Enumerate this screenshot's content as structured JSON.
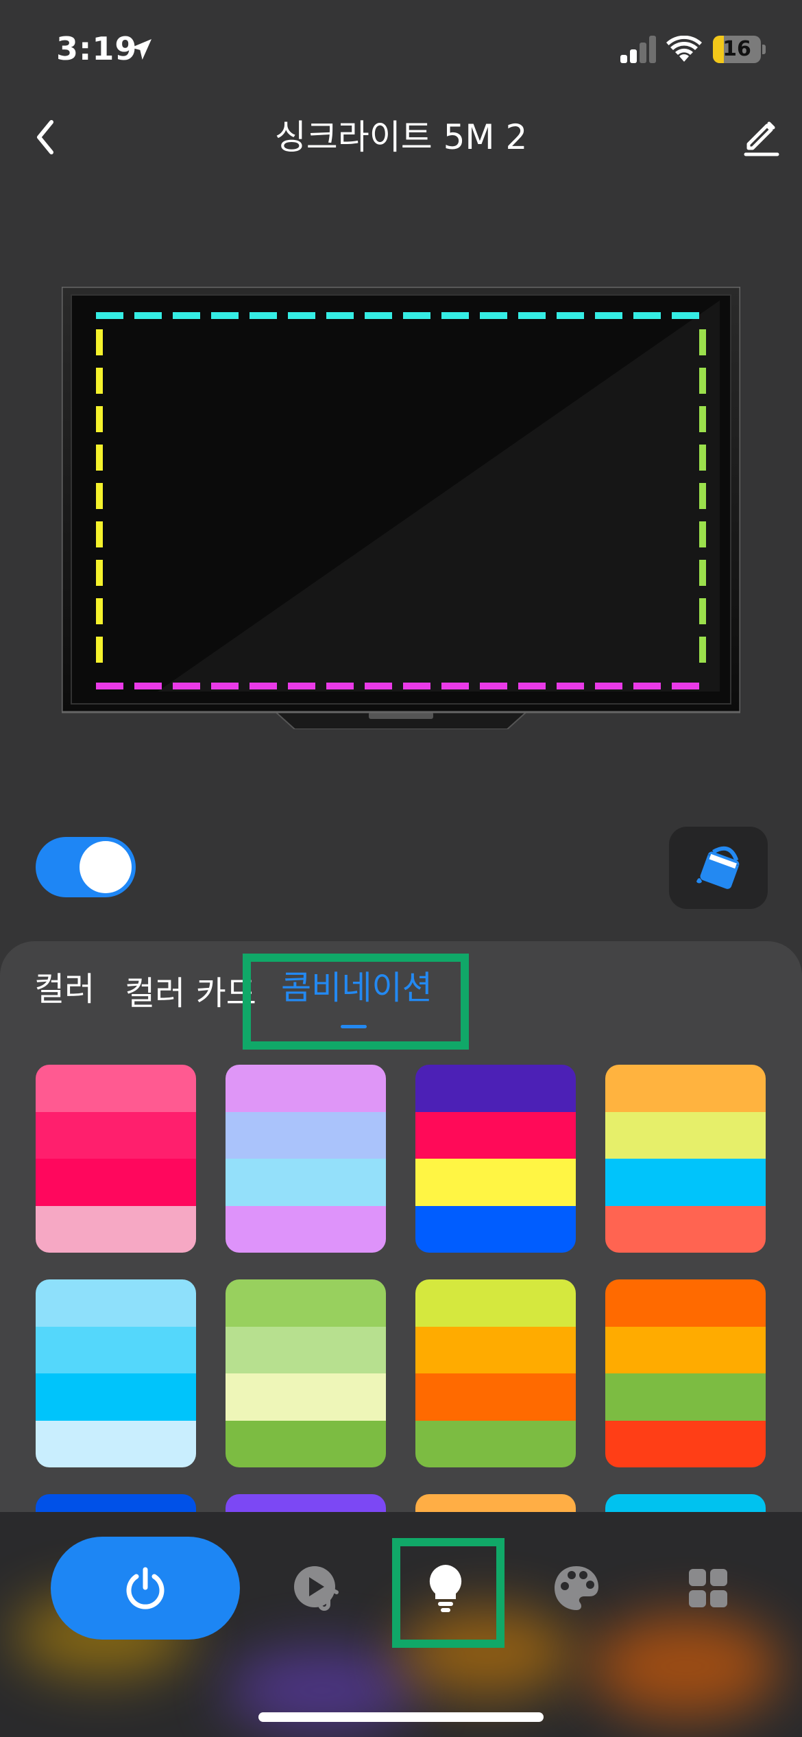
{
  "status_bar": {
    "time": "3:19",
    "battery": "16",
    "icons": [
      "location-arrow-icon",
      "signal-icon",
      "wifi-icon",
      "battery-icon"
    ]
  },
  "header": {
    "title": "싱크라이트 5M 2",
    "back_icon": "chevron-left-icon",
    "edit_icon": "pencil-icon"
  },
  "device": {
    "edge_colors": {
      "top": "#35ede4",
      "bottom": "#ea3ae8",
      "left": "#f5f22c",
      "right": "#9be04c"
    }
  },
  "controls": {
    "power_toggle_on": true,
    "paint_bucket_icon": "paint-bucket-icon"
  },
  "tabs": [
    {
      "label": "컬러",
      "active": false
    },
    {
      "label": "컬러 카드",
      "active": false
    },
    {
      "label": "콤비네이션",
      "active": true
    }
  ],
  "accent_color": "#2389f2",
  "combinations": [
    [
      "#ff5a91",
      "#ff1f6d",
      "#ff075d",
      "#f6a8c4"
    ],
    [
      "#df96f7",
      "#aac3fb",
      "#94e0fa",
      "#de93fa"
    ],
    [
      "#4c20b6",
      "#ff0a58",
      "#fff544",
      "#005dff"
    ],
    [
      "#ffb33f",
      "#e6ef6a",
      "#00c4fb",
      "#ff6451"
    ],
    [
      "#8ee0fb",
      "#54d7fb",
      "#00c4fb",
      "#c9eefe"
    ],
    [
      "#98d05e",
      "#b7e08f",
      "#eef6b8",
      "#7cbc42"
    ],
    [
      "#d5e83e",
      "#ffab00",
      "#ff6a00",
      "#7cbc42"
    ],
    [
      "#ff6a00",
      "#ffab00",
      "#7cbc42",
      "#ff3e16"
    ],
    [
      "#0051e8"
    ],
    [
      "#7c48f4"
    ],
    [
      "#ffae45"
    ],
    [
      "#00c2ef"
    ]
  ],
  "bottom_nav": {
    "items": [
      {
        "name": "power",
        "icon": "power-icon",
        "active": true
      },
      {
        "name": "music",
        "icon": "music-play-icon",
        "active": false
      },
      {
        "name": "light",
        "icon": "lightbulb-icon",
        "active": false
      },
      {
        "name": "palette",
        "icon": "palette-icon",
        "active": false
      },
      {
        "name": "apps",
        "icon": "grid-icon",
        "active": false
      }
    ]
  }
}
